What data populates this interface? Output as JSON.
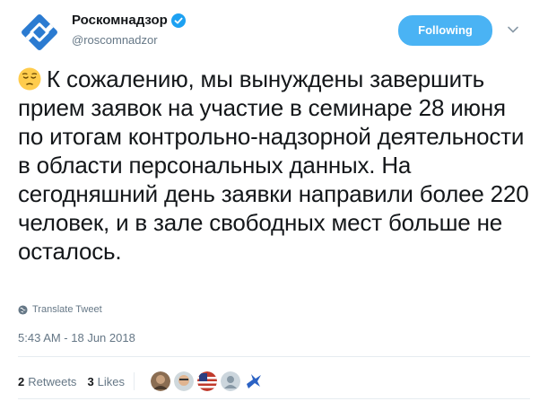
{
  "author": {
    "name": "Роскомнадзор",
    "handle": "@roscomnadzor",
    "verified_icon": "verified-badge-icon"
  },
  "follow_button": {
    "label": "Following"
  },
  "tweet": {
    "emoji": "pensive-face-emoji",
    "text": "К сожалению, мы вынуждены завершить прием заявок на участие в семинаре 28 июня по итогам контрольно-надзорной деятельности в области персональных данных. На сегодняшний день заявки направили более 220 человек, и в зале свободных мест больше не осталось.",
    "translate_label": "Translate Tweet",
    "timestamp": "5:43 AM - 18 Jun 2018"
  },
  "engagement": {
    "retweets_count": "2",
    "retweets_label": "Retweets",
    "likes_count": "3",
    "likes_label": "Likes"
  },
  "colors": {
    "accent": "#4ab3f4",
    "text": "#14171a",
    "muted": "#657786",
    "divider": "#e6ecf0",
    "logo_blue": "#2b7bd1"
  }
}
